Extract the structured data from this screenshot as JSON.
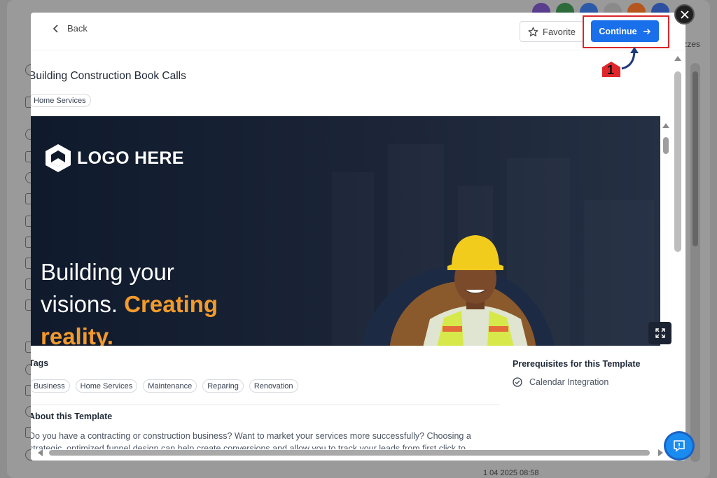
{
  "background": {
    "right_label": "izzes",
    "bottom_text": "1 04 2025 08:58"
  },
  "header": {
    "back_label": "Back",
    "favorite_label": "Favorite",
    "continue_label": "Continue"
  },
  "template": {
    "title": "Building Construction Book Calls",
    "category": "Home Services"
  },
  "hero": {
    "logo_text": "LOGO HERE",
    "headline_line1": "Building your",
    "headline_line2_plain": "visions. ",
    "headline_line2_accent": "Creating",
    "headline_line3_accent": "reality."
  },
  "tags": {
    "heading": "Tags",
    "items": [
      "Business",
      "Home Services",
      "Maintenance",
      "Reparing",
      "Renovation"
    ]
  },
  "about": {
    "heading": "About this Template",
    "text": "Do you have a contracting or construction business? Want to market your services more successfully? Choosing a strategic, optimized funnel design can help create conversions and allow you to track your leads from first click to"
  },
  "prerequisites": {
    "heading": "Prerequisites for this Template",
    "items": [
      "Calendar Integration"
    ]
  },
  "annotation": {
    "step_number": "1"
  },
  "colors": {
    "primary": "#1a6fea",
    "accent_orange": "#f39a2d",
    "highlight_red": "#d9262a",
    "hero_bg": "#0f1a2c"
  }
}
